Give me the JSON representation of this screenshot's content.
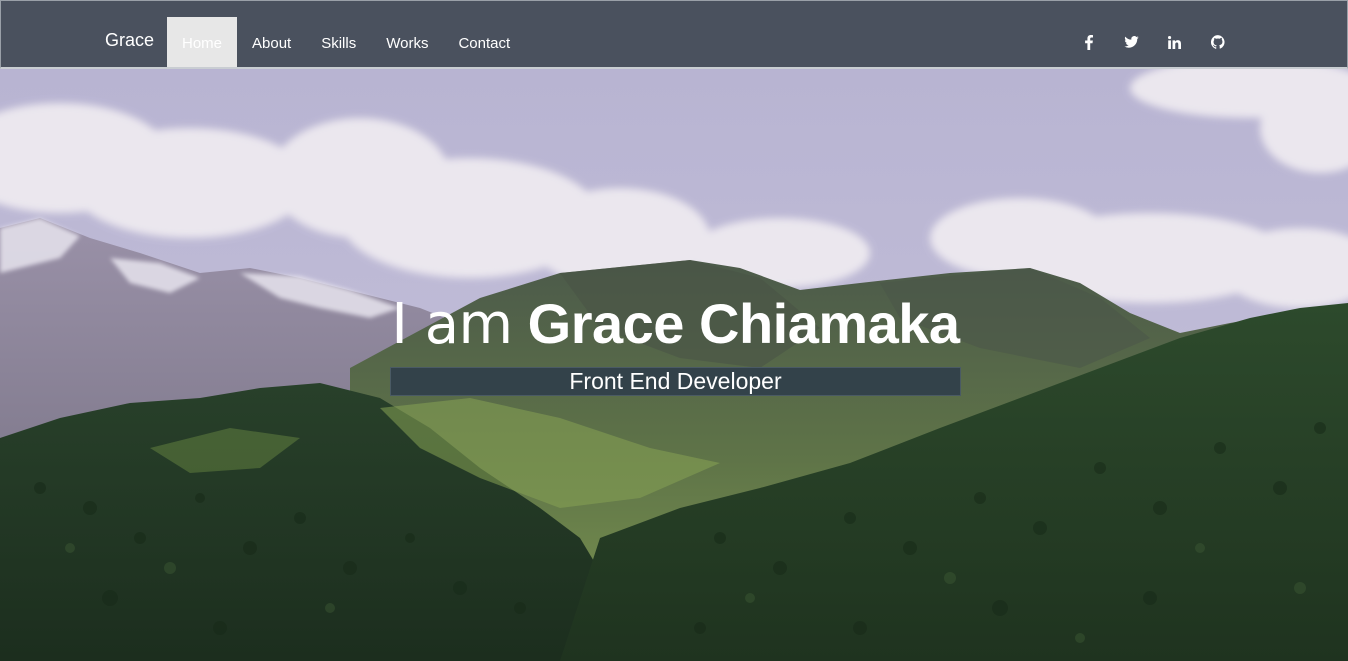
{
  "navbar": {
    "brand": "Grace",
    "links": [
      {
        "label": "Home",
        "active": true
      },
      {
        "label": "About",
        "active": false
      },
      {
        "label": "Skills",
        "active": false
      },
      {
        "label": "Works",
        "active": false
      },
      {
        "label": "Contact",
        "active": false
      }
    ],
    "social": [
      "facebook-icon",
      "twitter-icon",
      "linkedin-icon",
      "github-icon"
    ]
  },
  "hero": {
    "greeting": "I am",
    "name": "Grace Chiamaka",
    "role": "Front End Developer"
  },
  "colors": {
    "navbar_bg": "#4a515e",
    "active_tab_bg": "#e7e7e7",
    "role_bar_bg": "#33424a",
    "text": "#ffffff"
  }
}
